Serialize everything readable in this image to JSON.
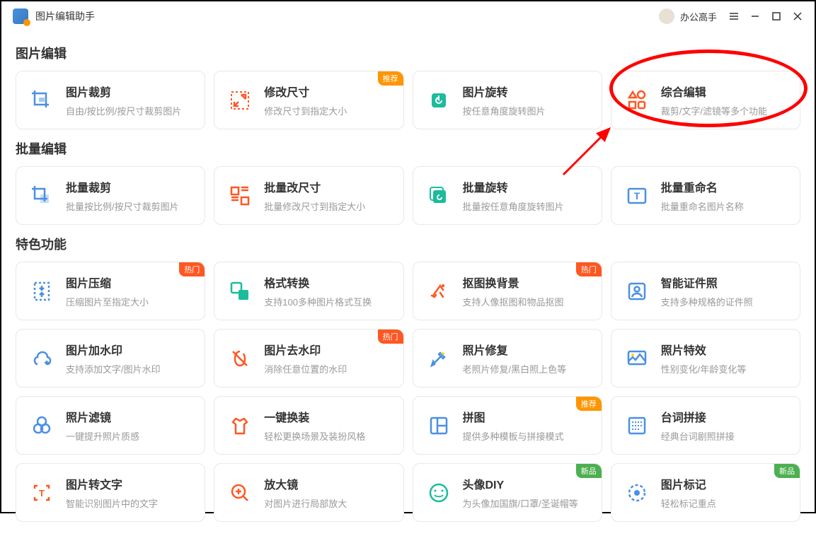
{
  "app": {
    "title": "图片编辑助手",
    "username": "办公高手"
  },
  "sections": {
    "edit": {
      "title": "图片编辑"
    },
    "batch": {
      "title": "批量编辑"
    },
    "special": {
      "title": "特色功能"
    }
  },
  "cards": {
    "crop": {
      "title": "图片裁剪",
      "desc": "自由/按比例/按尺寸裁剪图片"
    },
    "resize": {
      "title": "修改尺寸",
      "desc": "修改尺寸到指定大小",
      "badge": "推荐"
    },
    "rotate": {
      "title": "图片旋转",
      "desc": "按任意角度旋转图片"
    },
    "comprehensive": {
      "title": "综合编辑",
      "desc": "裁剪/文字/滤镜等多个功能"
    },
    "batchCrop": {
      "title": "批量裁剪",
      "desc": "批量按比例/按尺寸裁剪图片"
    },
    "batchResize": {
      "title": "批量改尺寸",
      "desc": "批量修改尺寸到指定大小"
    },
    "batchRotate": {
      "title": "批量旋转",
      "desc": "批量按任意角度旋转图片"
    },
    "batchRename": {
      "title": "批量重命名",
      "desc": "批量重命名图片名称"
    },
    "compress": {
      "title": "图片压缩",
      "desc": "压缩图片至指定大小",
      "badge": "热门"
    },
    "format": {
      "title": "格式转换",
      "desc": "支持100多种图片格式互换"
    },
    "cutout": {
      "title": "抠图换背景",
      "desc": "支持人像抠图和物品抠图",
      "badge": "热门"
    },
    "idPhoto": {
      "title": "智能证件照",
      "desc": "支持多种规格的证件照"
    },
    "addWatermark": {
      "title": "图片加水印",
      "desc": "支持添加文字/图片水印"
    },
    "removeWatermark": {
      "title": "图片去水印",
      "desc": "消除任意位置的水印",
      "badge": "热门"
    },
    "repair": {
      "title": "照片修复",
      "desc": "老照片修复/黑白照上色等"
    },
    "effect": {
      "title": "照片特效",
      "desc": "性别变化/年龄变化等"
    },
    "filter": {
      "title": "照片滤镜",
      "desc": "一键提升照片质感"
    },
    "outfit": {
      "title": "一键换装",
      "desc": "轻松更换场景及装扮风格"
    },
    "collage": {
      "title": "拼图",
      "desc": "提供多种模板与拼接模式",
      "badge": "推荐"
    },
    "dialogue": {
      "title": "台词拼接",
      "desc": "经典台词剧照拼接"
    },
    "ocr": {
      "title": "图片转文字",
      "desc": "智能识别图片中的文字"
    },
    "magnify": {
      "title": "放大镜",
      "desc": "对图片进行局部放大"
    },
    "avatarDiy": {
      "title": "头像DIY",
      "desc": "为头像加国旗/口罩/圣诞帽等",
      "badge": "新品"
    },
    "mark": {
      "title": "图片标记",
      "desc": "轻松标记重点",
      "badge": "新品"
    }
  }
}
